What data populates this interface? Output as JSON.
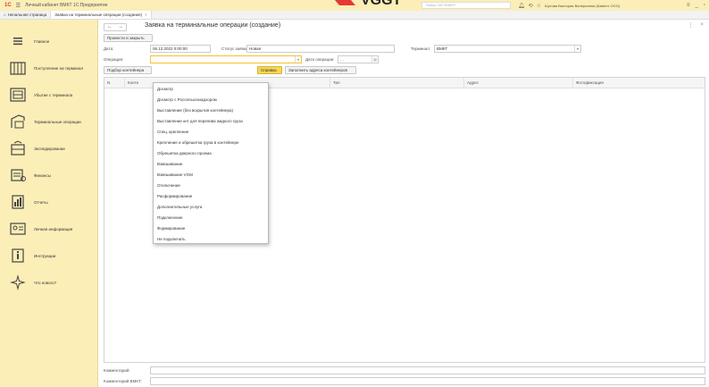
{
  "app": {
    "logo": "1С",
    "title": "Личный кабинет ВМКТ  1С:Предприятие",
    "search_placeholder": "Поиск Ctrl+Shift+F",
    "user": "Шутова Виктория Валерьевна (Бамент ООО)"
  },
  "tabs": [
    {
      "label": "Начальная страница"
    },
    {
      "label": "Заявка на терминальные операции (создание)"
    }
  ],
  "sidebar": {
    "items": [
      {
        "label": "Главное"
      },
      {
        "label": "Поступление на терминал"
      },
      {
        "label": "Убытие с терминала"
      },
      {
        "label": "Терминальные операции"
      },
      {
        "label": "Экспедирование"
      },
      {
        "label": "Финансы"
      },
      {
        "label": "Отчеты"
      },
      {
        "label": "Личная информация"
      },
      {
        "label": "Инструкции"
      },
      {
        "label": "Что нового?"
      }
    ]
  },
  "document": {
    "title": "Заявка на терминальные операции (создание)",
    "post_close": "Провести и закрыть",
    "date_label": "Дата:",
    "date_value": "06.12.2022  0:00:00",
    "status_label": "Статус заявки:",
    "status_value": "Новая",
    "terminal_label": "Терминал:",
    "terminal_value": "ВМКТ",
    "operation_label": "Операция:",
    "operation_value": "",
    "operation_date_label": "Дата операции:",
    "operation_date_value": ". .",
    "pick_containers": "Подбор контейнера",
    "help": "Справка",
    "fill_address": "Заполнить адреса контейнеров",
    "comment_label": "Комментарий:",
    "comment_vmkt_label": "Комментарий ВМКТ:"
  },
  "table": {
    "headers": [
      "N",
      "Конте",
      "Тип",
      "Адрес",
      "Фотофиксация"
    ]
  },
  "operations_dropdown": [
    "Досмотр",
    "Досмотр с Россельхознадзором",
    "Выставление (без вскрытия контейнера)",
    "Выставление кнт для перелива жидкого груза",
    "Спец. крепление",
    "Крепление и обрешетка груза в контейнере",
    "Обрешетка дверного проема",
    "Взвешивание",
    "Взвешивание VGM",
    "Отключение",
    "Расформирование",
    "Дополнительные услуги",
    "Подключение",
    "Формирование",
    "Не подключать"
  ],
  "colors": {
    "sidebar_bg": "#fbeeb7",
    "accent_yellow": "#f9d650",
    "logo_red": "#e53935"
  }
}
